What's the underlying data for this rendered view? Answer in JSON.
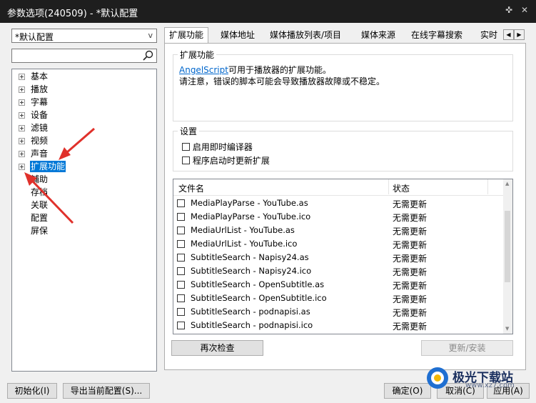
{
  "window": {
    "title": "参数选项(240509) - *默认配置",
    "pin_glyph": "✜",
    "close_glyph": "✕"
  },
  "profile_combo": {
    "value": "*默认配置",
    "arrow": "v"
  },
  "search": {
    "value": "",
    "placeholder": ""
  },
  "tree": {
    "items": [
      {
        "label": "基本",
        "expandable": true,
        "selected": false
      },
      {
        "label": "播放",
        "expandable": true,
        "selected": false
      },
      {
        "label": "字幕",
        "expandable": true,
        "selected": false
      },
      {
        "label": "设备",
        "expandable": true,
        "selected": false
      },
      {
        "label": "滤镜",
        "expandable": true,
        "selected": false
      },
      {
        "label": "视频",
        "expandable": true,
        "selected": false
      },
      {
        "label": "声音",
        "expandable": true,
        "selected": false
      },
      {
        "label": "扩展功能",
        "expandable": true,
        "selected": true
      },
      {
        "label": "辅助",
        "expandable": false,
        "selected": false
      },
      {
        "label": "存档",
        "expandable": false,
        "selected": false
      },
      {
        "label": "关联",
        "expandable": false,
        "selected": false
      },
      {
        "label": "配置",
        "expandable": false,
        "selected": false
      },
      {
        "label": "屏保",
        "expandable": false,
        "selected": false
      }
    ]
  },
  "tabs": [
    {
      "label": "扩展功能",
      "active": true
    },
    {
      "label": "媒体地址",
      "active": false
    },
    {
      "label": "媒体播放列表/项目",
      "active": false
    },
    {
      "label": "媒体来源",
      "active": false
    },
    {
      "label": "在线字幕搜索",
      "active": false
    },
    {
      "label": "实时",
      "active": false
    }
  ],
  "tab_scroll": {
    "left": "◀",
    "right": "▶"
  },
  "extension_group": {
    "title": "扩展功能",
    "link": "AngelScript",
    "line1_rest": "可用于播放器的扩展功能。",
    "line2": "请注意，错误的脚本可能会导致播放器故障或不稳定。"
  },
  "settings_group": {
    "title": "设置",
    "options": [
      {
        "label": "启用即时编译器",
        "checked": false
      },
      {
        "label": "程序启动时更新扩展",
        "checked": false
      }
    ]
  },
  "file_list": {
    "columns": [
      "文件名",
      "状态"
    ],
    "rows": [
      {
        "name": "MediaPlayParse - YouTube.as",
        "status": "无需更新",
        "checked": false
      },
      {
        "name": "MediaPlayParse - YouTube.ico",
        "status": "无需更新",
        "checked": false
      },
      {
        "name": "MediaUrlList - YouTube.as",
        "status": "无需更新",
        "checked": false
      },
      {
        "name": "MediaUrlList - YouTube.ico",
        "status": "无需更新",
        "checked": false
      },
      {
        "name": "SubtitleSearch - Napisy24.as",
        "status": "无需更新",
        "checked": false
      },
      {
        "name": "SubtitleSearch - Napisy24.ico",
        "status": "无需更新",
        "checked": false
      },
      {
        "name": "SubtitleSearch - OpenSubtitle.as",
        "status": "无需更新",
        "checked": false
      },
      {
        "name": "SubtitleSearch - OpenSubtitle.ico",
        "status": "无需更新",
        "checked": false
      },
      {
        "name": "SubtitleSearch - podnapisi.as",
        "status": "无需更新",
        "checked": false
      },
      {
        "name": "SubtitleSearch - podnapisi.ico",
        "status": "无需更新",
        "checked": false
      }
    ]
  },
  "buttons": {
    "recheck": "再次检查",
    "update_install": "更新/安装",
    "initialize": "初始化(I)",
    "export": "导出当前配置(S)...",
    "ok": "确定(O)",
    "cancel": "取消(C)",
    "apply": "应用(A)"
  },
  "watermark": {
    "text": "极光下载站",
    "url": "www.xz7.com"
  },
  "colors": {
    "selection": "#0078d7",
    "link": "#0066cc",
    "annotation_arrow": "#e0312b",
    "titlebar": "#1e1e1e"
  }
}
